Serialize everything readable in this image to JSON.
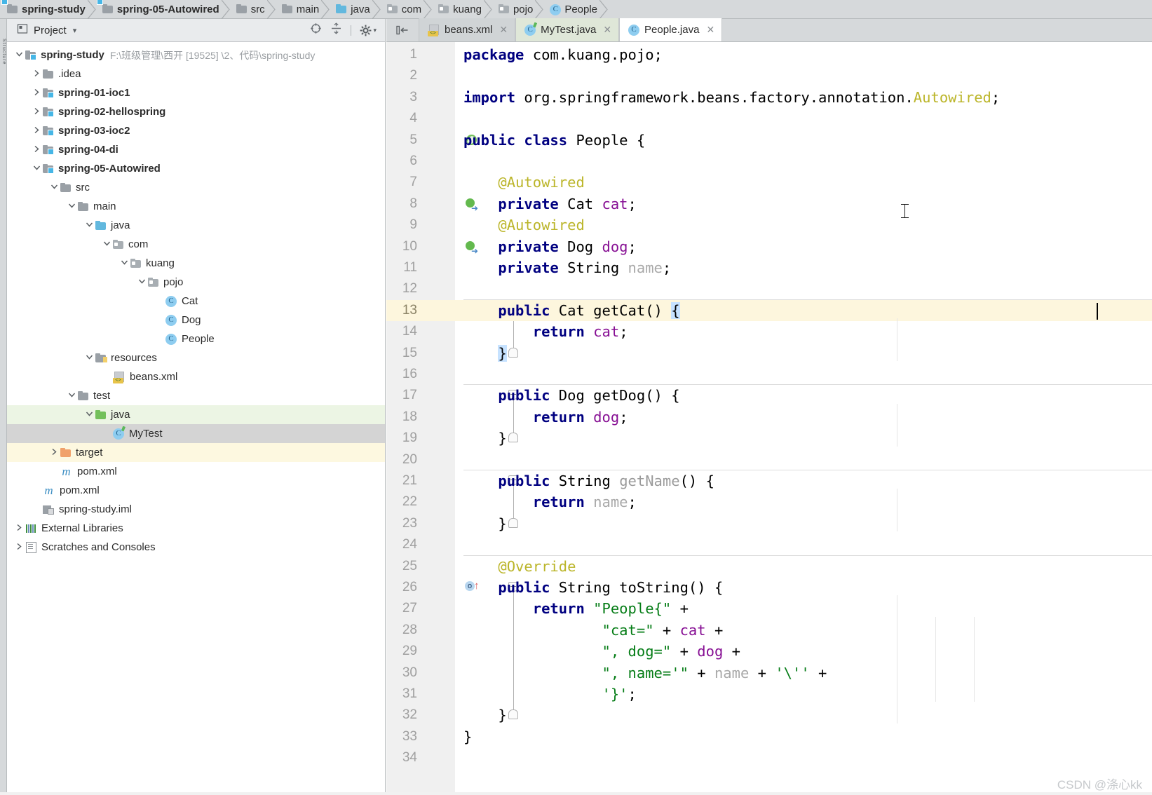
{
  "breadcrumb": {
    "items": [
      {
        "label": "spring-study",
        "icon": "module-folder-icon",
        "bold": true
      },
      {
        "label": "spring-05-Autowired",
        "icon": "module-folder-icon",
        "bold": true
      },
      {
        "label": "src",
        "icon": "folder-icon",
        "bold": false
      },
      {
        "label": "main",
        "icon": "folder-icon",
        "bold": false
      },
      {
        "label": "java",
        "icon": "source-folder-icon",
        "bold": false
      },
      {
        "label": "com",
        "icon": "package-folder-icon",
        "bold": false
      },
      {
        "label": "kuang",
        "icon": "package-folder-icon",
        "bold": false
      },
      {
        "label": "pojo",
        "icon": "package-folder-icon",
        "bold": false
      },
      {
        "label": "People",
        "icon": "java-class-icon",
        "bold": false
      }
    ]
  },
  "left_strip": {
    "label": "Structure"
  },
  "project_panel": {
    "title": "Project",
    "dropdown_caret": "▾",
    "icons": [
      {
        "name": "select-opened-file-icon",
        "glyph": "locate"
      },
      {
        "name": "collapse-all-icon",
        "glyph": "collapse"
      },
      {
        "name": "settings-gear-icon",
        "glyph": "gear"
      }
    ],
    "tree": [
      {
        "label": "spring-study",
        "path": "F:\\班级管理\\西开 [19525] \\2、代码\\spring-study",
        "indent": 0,
        "arrow": "v",
        "icon": "module-folder-icon",
        "bold": true,
        "bg": "none"
      },
      {
        "label": ".idea",
        "path": "",
        "indent": 1,
        "arrow": ">",
        "icon": "folder-icon",
        "bold": false,
        "bg": "none"
      },
      {
        "label": "spring-01-ioc1",
        "path": "",
        "indent": 1,
        "arrow": ">",
        "icon": "module-folder-icon",
        "bold": true,
        "bg": "none"
      },
      {
        "label": "spring-02-hellospring",
        "path": "",
        "indent": 1,
        "arrow": ">",
        "icon": "module-folder-icon",
        "bold": true,
        "bg": "none"
      },
      {
        "label": "spring-03-ioc2",
        "path": "",
        "indent": 1,
        "arrow": ">",
        "icon": "module-folder-icon",
        "bold": true,
        "bg": "none"
      },
      {
        "label": "spring-04-di",
        "path": "",
        "indent": 1,
        "arrow": ">",
        "icon": "module-folder-icon",
        "bold": true,
        "bg": "none"
      },
      {
        "label": "spring-05-Autowired",
        "path": "",
        "indent": 1,
        "arrow": "v",
        "icon": "module-folder-icon",
        "bold": true,
        "bg": "none"
      },
      {
        "label": "src",
        "path": "",
        "indent": 2,
        "arrow": "v",
        "icon": "folder-icon",
        "bold": false,
        "bg": "none"
      },
      {
        "label": "main",
        "path": "",
        "indent": 3,
        "arrow": "v",
        "icon": "folder-icon",
        "bold": false,
        "bg": "none"
      },
      {
        "label": "java",
        "path": "",
        "indent": 4,
        "arrow": "v",
        "icon": "source-folder-icon",
        "bold": false,
        "bg": "none"
      },
      {
        "label": "com",
        "path": "",
        "indent": 5,
        "arrow": "v",
        "icon": "package-folder-icon",
        "bold": false,
        "bg": "none"
      },
      {
        "label": "kuang",
        "path": "",
        "indent": 6,
        "arrow": "v",
        "icon": "package-folder-icon",
        "bold": false,
        "bg": "none"
      },
      {
        "label": "pojo",
        "path": "",
        "indent": 7,
        "arrow": "v",
        "icon": "package-folder-icon",
        "bold": false,
        "bg": "none"
      },
      {
        "label": "Cat",
        "path": "",
        "indent": 8,
        "arrow": "",
        "icon": "java-class-icon",
        "bold": false,
        "bg": "none"
      },
      {
        "label": "Dog",
        "path": "",
        "indent": 8,
        "arrow": "",
        "icon": "java-class-icon",
        "bold": false,
        "bg": "none"
      },
      {
        "label": "People",
        "path": "",
        "indent": 8,
        "arrow": "",
        "icon": "java-class-icon",
        "bold": false,
        "bg": "none"
      },
      {
        "label": "resources",
        "path": "",
        "indent": 4,
        "arrow": "v",
        "icon": "resources-folder-icon",
        "bold": false,
        "bg": "none"
      },
      {
        "label": "beans.xml",
        "path": "",
        "indent": 5,
        "arrow": "",
        "icon": "xml-file-icon",
        "bold": false,
        "bg": "none"
      },
      {
        "label": "test",
        "path": "",
        "indent": 3,
        "arrow": "v",
        "icon": "folder-icon",
        "bold": false,
        "bg": "none"
      },
      {
        "label": "java",
        "path": "",
        "indent": 4,
        "arrow": "v",
        "icon": "test-source-folder-icon",
        "bold": false,
        "bg": "green"
      },
      {
        "label": "MyTest",
        "path": "",
        "indent": 5,
        "arrow": "",
        "icon": "java-test-class-icon",
        "bold": false,
        "bg": "selected"
      },
      {
        "label": "target",
        "path": "",
        "indent": 2,
        "arrow": ">",
        "icon": "excluded-folder-icon",
        "bold": false,
        "bg": "yellow"
      },
      {
        "label": "pom.xml",
        "path": "",
        "indent": 2,
        "arrow": "",
        "icon": "maven-file-icon",
        "bold": false,
        "bg": "none"
      },
      {
        "label": "pom.xml",
        "path": "",
        "indent": 1,
        "arrow": "",
        "icon": "maven-file-icon",
        "bold": false,
        "bg": "none"
      },
      {
        "label": "spring-study.iml",
        "path": "",
        "indent": 1,
        "arrow": "",
        "icon": "iml-file-icon",
        "bold": false,
        "bg": "none"
      },
      {
        "label": "External Libraries",
        "path": "",
        "indent": 0,
        "arrow": ">",
        "icon": "external-libraries-icon",
        "bold": false,
        "bg": "none"
      },
      {
        "label": "Scratches and Consoles",
        "path": "",
        "indent": 0,
        "arrow": ">",
        "icon": "scratches-icon",
        "bold": false,
        "bg": "none"
      }
    ]
  },
  "editor": {
    "tabs": [
      {
        "label": "beans.xml",
        "icon": "xml-file-icon",
        "state": "inactive",
        "close": "✕"
      },
      {
        "label": "MyTest.java",
        "icon": "java-test-class-icon",
        "state": "active-file",
        "close": "✕"
      },
      {
        "label": "People.java",
        "icon": "java-class-icon",
        "state": "active",
        "close": "✕"
      }
    ],
    "hide_panel_icon": "hide-tool-window-icon",
    "current_line": 13,
    "caret": {
      "line": 13,
      "column": 26
    },
    "lines": [
      {
        "n": 1,
        "code": "package com.kuang.pojo;"
      },
      {
        "n": 2,
        "code": ""
      },
      {
        "n": 3,
        "code": "import org.springframework.beans.factory.annotation.Autowired;"
      },
      {
        "n": 4,
        "code": ""
      },
      {
        "n": 5,
        "code": "public class People {",
        "gutter": "spring-bean-icon"
      },
      {
        "n": 6,
        "code": ""
      },
      {
        "n": 7,
        "code": "    @Autowired"
      },
      {
        "n": 8,
        "code": "    private Cat cat;",
        "gutter": "autowired-dependency-icon"
      },
      {
        "n": 9,
        "code": "    @Autowired"
      },
      {
        "n": 10,
        "code": "    private Dog dog;",
        "gutter": "autowired-dependency-icon"
      },
      {
        "n": 11,
        "code": "    private String name;"
      },
      {
        "n": 12,
        "code": ""
      },
      {
        "n": 13,
        "code": "    public Cat getCat() {",
        "fold": "start"
      },
      {
        "n": 14,
        "code": "        return cat;"
      },
      {
        "n": 15,
        "code": "    }",
        "fold": "end"
      },
      {
        "n": 16,
        "code": ""
      },
      {
        "n": 17,
        "code": "    public Dog getDog() {",
        "fold": "start"
      },
      {
        "n": 18,
        "code": "        return dog;"
      },
      {
        "n": 19,
        "code": "    }",
        "fold": "end"
      },
      {
        "n": 20,
        "code": ""
      },
      {
        "n": 21,
        "code": "    public String getName() {",
        "fold": "start"
      },
      {
        "n": 22,
        "code": "        return name;"
      },
      {
        "n": 23,
        "code": "    }",
        "fold": "end"
      },
      {
        "n": 24,
        "code": ""
      },
      {
        "n": 25,
        "code": "    @Override"
      },
      {
        "n": 26,
        "code": "    public String toString() {",
        "gutter": "override-method-icon",
        "fold": "start"
      },
      {
        "n": 27,
        "code": "        return \"People{\" +"
      },
      {
        "n": 28,
        "code": "                \"cat=\" + cat +"
      },
      {
        "n": 29,
        "code": "                \", dog=\" + dog +"
      },
      {
        "n": 30,
        "code": "                \", name='\" + name + '\\'' +"
      },
      {
        "n": 31,
        "code": "                '}';"
      },
      {
        "n": 32,
        "code": "    }",
        "fold": "end"
      },
      {
        "n": 33,
        "code": "}"
      },
      {
        "n": 34,
        "code": ""
      }
    ]
  },
  "watermark": "CSDN @涤心kk",
  "colors": {
    "keyword": "#000080",
    "annotation": "#bbb529",
    "field": "#871094",
    "string": "#067d17",
    "unused": "#a9a9a9",
    "current_line_bg": "#fdf6dd",
    "brace_match_bg": "#c6e2ff",
    "selection_bg": "#d4d4d4",
    "test_source_bg": "#ecf5e4",
    "excluded_bg": "#fdf8e0",
    "chrome_bg": "#d6d9db",
    "gutter_bg": "#f0f0f0"
  }
}
